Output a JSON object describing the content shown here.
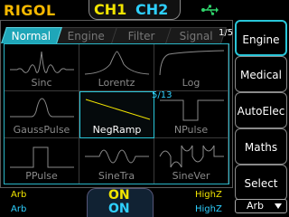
{
  "header": {
    "brand": "RIGOL",
    "ch1_label": "CH1",
    "ch2_label": "CH2",
    "status_icon": "usb-icon"
  },
  "tabs": [
    {
      "label": "Normal",
      "active": true
    },
    {
      "label": "Engine",
      "active": false
    },
    {
      "label": "Filter",
      "active": false
    },
    {
      "label": "Signal",
      "active": false
    }
  ],
  "page_indicator": "1/5",
  "sub_page_indicator": "5/13",
  "waveforms": [
    {
      "label": "Sinc",
      "shape": "sinc"
    },
    {
      "label": "Lorentz",
      "shape": "lorentz"
    },
    {
      "label": "Log",
      "shape": "log"
    },
    {
      "label": "GaussPulse",
      "shape": "gausspulse"
    },
    {
      "label": "NegRamp",
      "shape": "negramp",
      "selected": true
    },
    {
      "label": "NPulse",
      "shape": "npulse"
    },
    {
      "label": "PPulse",
      "shape": "ppulse"
    },
    {
      "label": "SineTra",
      "shape": "sinetra"
    },
    {
      "label": "SineVer",
      "shape": "sinever"
    }
  ],
  "softkeys": [
    {
      "label": "Engine",
      "active": true
    },
    {
      "label": "Medical",
      "active": false
    },
    {
      "label": "AutoElec",
      "active": false
    },
    {
      "label": "Maths",
      "active": false
    },
    {
      "label": "Select",
      "active": false
    }
  ],
  "pager": {
    "label": "Arb"
  },
  "status": {
    "ch1_mode": "Arb",
    "ch2_mode": "Arb",
    "ch1_output": "ON",
    "ch2_output": "ON",
    "ch1_load": "HighZ",
    "ch2_load": "HighZ"
  },
  "colors": {
    "ch1": "#f2e500",
    "ch2": "#2ed0ff",
    "accent": "#1fa6b8",
    "brand": "#f5b800"
  }
}
